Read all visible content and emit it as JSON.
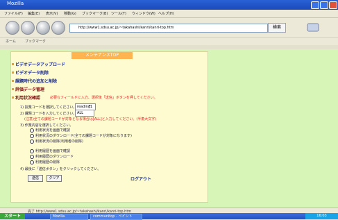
{
  "window": {
    "title": "Mozilla",
    "close": "×",
    "minimize": "_",
    "maximize": "□"
  },
  "menu": [
    "ファイル(F)",
    "編集(E)",
    "表示(V)",
    "移動(G)",
    "ブックマーク(B)",
    "ツール(T)",
    "ウィンドウ(W)",
    "ヘルプ(H)"
  ],
  "url": {
    "value": "http://www1.sdsu.ac.jp/~takahashi/kanri/kanri-top.htm",
    "go_label": "検索"
  },
  "bookmarks": [
    "ホーム",
    "ブックマーク"
  ],
  "page": {
    "title": "メンテナンスTOP",
    "menu_items": [
      "ビデオデータアップロード",
      "ビデオデータ削除",
      "課題時代の追加と削除",
      "評価データ管理"
    ],
    "section_label": "利用状況確認",
    "section_note": "必要なフィールドに入力、選択後「送信」ボタンを押してください。",
    "row1_label": "1) 授業コードを選択してください。",
    "row1_value": "reading1",
    "row2_label": "2) 課題コードを入力してください。",
    "row2_value": "ALL",
    "note": "(注意)全ての課題コードが対象となる場合は[ALL]と入力してください。(半角大文字)",
    "row3_label": "3) 作業内容を選択してください。",
    "radio_group1": [
      "利用状況を画面で確認",
      "利用状況のダウンロード(全ての課題コードが対象になります)",
      "利用状況の削除(利用者の削除)"
    ],
    "radio_group2": [
      "利用履歴を画面で確認",
      "利用履歴のダウンロード",
      "利用履歴の削除"
    ],
    "row4_label": "4) 最後に「送信ボタン」をクリックしてください。",
    "submit": "送信",
    "clear": "クリア",
    "logout": "ログアウト"
  },
  "status": {
    "text": "完了 http://www1.sdsu.ac.jp/~takahashi/kanri/kanri-top.htm"
  },
  "taskbar": {
    "start": "スタート",
    "items": [
      "Mozilla",
      "communitop - ペイント"
    ],
    "clock": "16:03"
  }
}
